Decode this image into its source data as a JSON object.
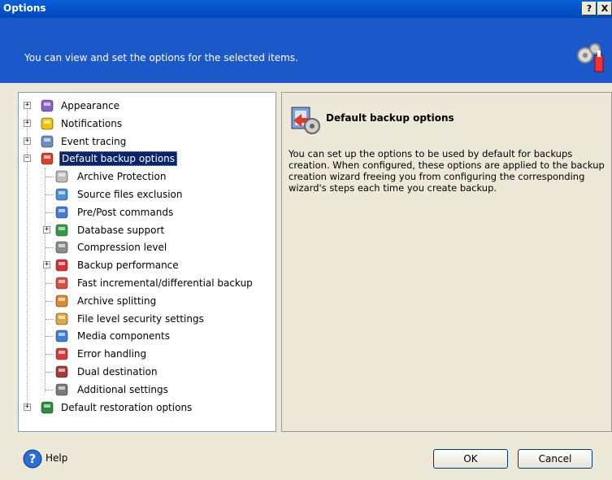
{
  "window": {
    "title": "Options",
    "help_button": "?",
    "close_button": "X"
  },
  "header": {
    "description": "You can view and set the options for the selected items."
  },
  "tree": {
    "items": [
      {
        "label": "Appearance",
        "icon": "appearance-icon",
        "expandable": true,
        "expanded": false
      },
      {
        "label": "Notifications",
        "icon": "notifications-icon",
        "expandable": true,
        "expanded": false
      },
      {
        "label": "Event tracing",
        "icon": "event-tracing-icon",
        "expandable": true,
        "expanded": false
      },
      {
        "label": "Default backup options",
        "icon": "backup-options-icon",
        "expandable": true,
        "expanded": true,
        "selected": true
      },
      {
        "label": "Archive Protection",
        "icon": "lock-icon",
        "child": true
      },
      {
        "label": "Source files exclusion",
        "icon": "filter-icon",
        "child": true
      },
      {
        "label": "Pre/Post commands",
        "icon": "window-icon",
        "child": true
      },
      {
        "label": "Database support",
        "icon": "shield-icon",
        "child": true,
        "expandable": true
      },
      {
        "label": "Compression level",
        "icon": "compression-icon",
        "child": true
      },
      {
        "label": "Backup performance",
        "icon": "gauge-icon",
        "child": true,
        "expandable": true
      },
      {
        "label": "Fast incremental/differential backup",
        "icon": "fast-backup-icon",
        "child": true
      },
      {
        "label": "Archive splitting",
        "icon": "split-icon",
        "child": true
      },
      {
        "label": "File level security settings",
        "icon": "security-folder-icon",
        "child": true
      },
      {
        "label": "Media components",
        "icon": "media-icon",
        "child": true
      },
      {
        "label": "Error handling",
        "icon": "error-icon",
        "child": true
      },
      {
        "label": "Dual destination",
        "icon": "dual-destination-icon",
        "child": true
      },
      {
        "label": "Additional settings",
        "icon": "settings-icon",
        "child": true
      },
      {
        "label": "Default restoration options",
        "icon": "restoration-icon",
        "expandable": true,
        "expanded": false
      }
    ]
  },
  "detail": {
    "title": "Default backup options",
    "text": "You can set up the options to be used by default for backups creation. When configured, these options are applied to the backup creation wizard freeing you from configuring the corresponding wizard's steps each time you create backup."
  },
  "footer": {
    "help_label": "Help",
    "ok_label": "OK",
    "cancel_label": "Cancel"
  },
  "colors": {
    "titlebar": "#0047b9",
    "header": "#1b58c9",
    "selection": "#0a246a",
    "dialog_bg": "#ece9d8"
  }
}
